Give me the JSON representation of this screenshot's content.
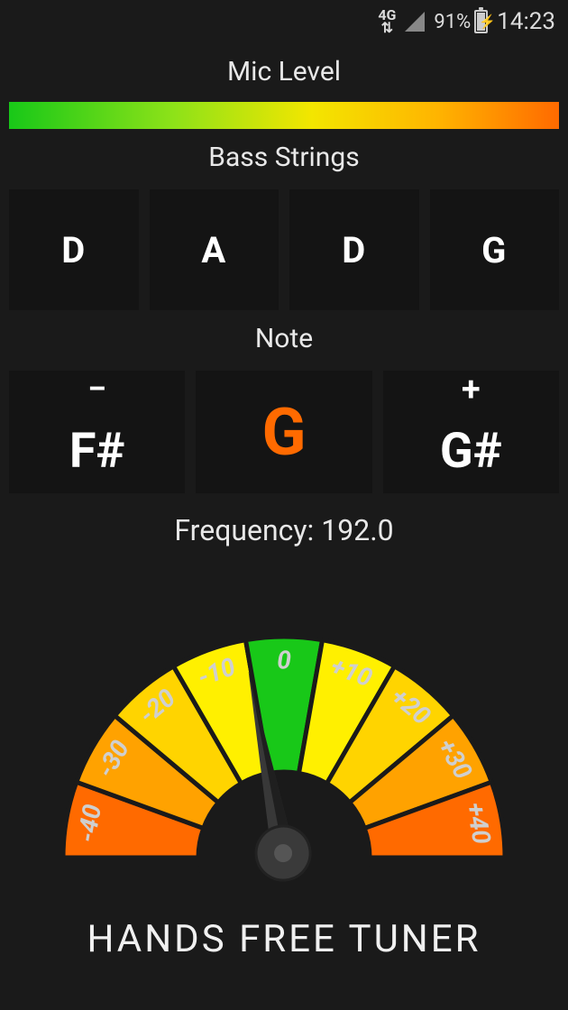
{
  "status": {
    "network": "4G",
    "battery_pct": "91%",
    "time": "14:23"
  },
  "mic": {
    "title": "Mic Level"
  },
  "strings": {
    "title": "Bass Strings",
    "items": [
      "D",
      "A",
      "D",
      "G"
    ]
  },
  "note": {
    "title": "Note",
    "minus": "−",
    "plus": "+",
    "prev": "F#",
    "current": "G",
    "next": "G#"
  },
  "frequency": {
    "label": "Frequency:",
    "value": "192.0"
  },
  "gauge": {
    "ticks": [
      "-40",
      "-30",
      "-20",
      "-10",
      "0",
      "+10",
      "+20",
      "+30",
      "+40"
    ],
    "needle_value": -6
  },
  "footer": "HANDS FREE TUNER"
}
